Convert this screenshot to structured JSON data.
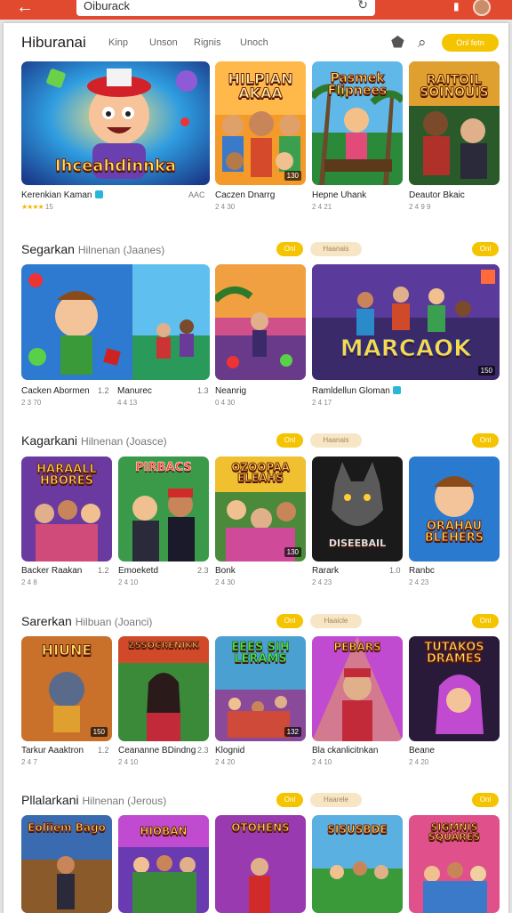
{
  "topbar": {
    "back_icon": "arrow-left-icon",
    "search_text": "Oiburack",
    "icons": [
      "refresh-icon",
      "bookmark-icon",
      "avatar"
    ]
  },
  "header": {
    "title": "Hiburanai",
    "nav": [
      "Kinp",
      "Unson",
      "Rignis",
      "Unoch"
    ],
    "cta": "Onl fetn"
  },
  "sections": [
    {
      "title": "",
      "subtitle": "",
      "pill_yellow": "",
      "pill_beige": "",
      "items": [
        {
          "name": "Kerenkian Kaman",
          "num": "",
          "rating": "15",
          "badge": "",
          "tile_text": "Ihceahdinnka",
          "icon": "verified-icon"
        },
        {
          "name": "Caczen Dnarrg",
          "num": "",
          "rating": "2 4 30",
          "badge": "130",
          "tile_text": "HILPIAN AKAA"
        },
        {
          "name": "Hepne Uhank",
          "num": "AAC",
          "rating": "2 4 21",
          "badge": "",
          "tile_text": "Pasmek Flipnees"
        },
        {
          "name": "Deautor Bkaic",
          "num": "",
          "rating": "2 4 9 9",
          "badge": "",
          "tile_text": "RAITOIL SOINOUIS"
        }
      ]
    },
    {
      "title": "Segarkan",
      "subtitle": "Hilnenan (Jaanes)",
      "pill_yellow": "Onl",
      "pill_beige": "Haanais",
      "items": [
        {
          "name": "Cacken Abormen",
          "num": "1.2",
          "rating": "2 3 70",
          "badge": "",
          "tile_text": ""
        },
        {
          "name": "Manurec",
          "num": "1.3",
          "rating": "4 4 13",
          "badge": "",
          "tile_text": ""
        },
        {
          "name": "Neanrig",
          "num": "",
          "rating": "0 4 30",
          "badge": "",
          "tile_text": ""
        },
        {
          "name": "Ramldellun Gloman",
          "num": "",
          "rating": "2 4 17",
          "badge": "150",
          "tile_text": "MARCAOK",
          "icon": "verified-icon"
        }
      ]
    },
    {
      "title": "Kagarkani",
      "subtitle": "Hilnenan (Joasce)",
      "pill_yellow": "Onl",
      "pill_beige": "Haanais",
      "items": [
        {
          "name": "Backer Raakan",
          "num": "1.2",
          "rating": "2 4 8",
          "badge": "",
          "tile_text": "HARAALL HBORES"
        },
        {
          "name": "Emoeketd",
          "num": "2.3",
          "rating": "2 4 10",
          "badge": "",
          "tile_text": "PIRBACS"
        },
        {
          "name": "Bonk",
          "num": "",
          "rating": "2 4 30",
          "badge": "130",
          "tile_text": "OZOOPAA ELEAHS"
        },
        {
          "name": "Rarark",
          "num": "1.0",
          "rating": "2 4 23",
          "badge": "",
          "tile_text": "DISEEBAIL"
        },
        {
          "name": "Ranbc",
          "num": "",
          "rating": "2 4 23",
          "badge": "",
          "tile_text": "ORAHAU BLEHERS"
        }
      ]
    },
    {
      "title": "Sarerkan",
      "subtitle": "Hilbuan (Joanci)",
      "pill_yellow": "Onl",
      "pill_beige": "Haaicle",
      "items": [
        {
          "name": "Tarkur Aaaktron",
          "num": "1.2",
          "rating": "2 4 7",
          "badge": "150",
          "tile_text": "HIUNE"
        },
        {
          "name": "Ceananne BDindng",
          "num": "2.3",
          "rating": "2 4 10",
          "badge": "",
          "tile_text": "ZSSOCRENIKK"
        },
        {
          "name": "Klognid",
          "num": "",
          "rating": "2 4 20",
          "badge": "132",
          "tile_text": "EEES SIH LERAMS"
        },
        {
          "name": "Bla ckanlicitnkan",
          "num": "",
          "rating": "2 4 10",
          "badge": "",
          "tile_text": "PEBARS"
        },
        {
          "name": "Beane",
          "num": "",
          "rating": "2 4 20",
          "badge": "",
          "tile_text": "TUTAKOS DRAMES"
        }
      ]
    },
    {
      "title": "Pllalarkani",
      "subtitle": "Hilnenan (Jerous)",
      "pill_yellow": "Onl",
      "pill_beige": "Haarele",
      "items": [
        {
          "name": "",
          "num": "",
          "rating": "",
          "badge": "",
          "tile_text": "Eoliiem Bago"
        },
        {
          "name": "",
          "num": "",
          "rating": "",
          "badge": "",
          "tile_text": "HIOBAN"
        },
        {
          "name": "",
          "num": "",
          "rating": "",
          "badge": "",
          "tile_text": "OTOHENS"
        },
        {
          "name": "",
          "num": "",
          "rating": "",
          "badge": "",
          "tile_text": "SISUSBDE"
        },
        {
          "name": "",
          "num": "",
          "rating": "",
          "badge": "",
          "tile_text": "SIGMNIS SQUARES"
        }
      ]
    }
  ]
}
